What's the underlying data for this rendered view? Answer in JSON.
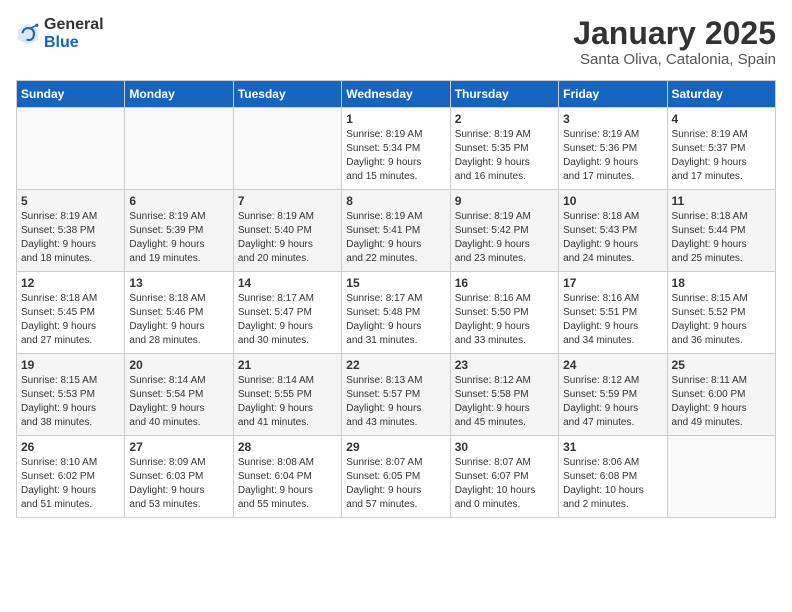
{
  "header": {
    "logo_general": "General",
    "logo_blue": "Blue",
    "month_year": "January 2025",
    "location": "Santa Oliva, Catalonia, Spain"
  },
  "weekdays": [
    "Sunday",
    "Monday",
    "Tuesday",
    "Wednesday",
    "Thursday",
    "Friday",
    "Saturday"
  ],
  "weeks": [
    [
      {
        "day": "",
        "text": ""
      },
      {
        "day": "",
        "text": ""
      },
      {
        "day": "",
        "text": ""
      },
      {
        "day": "1",
        "text": "Sunrise: 8:19 AM\nSunset: 5:34 PM\nDaylight: 9 hours\nand 15 minutes."
      },
      {
        "day": "2",
        "text": "Sunrise: 8:19 AM\nSunset: 5:35 PM\nDaylight: 9 hours\nand 16 minutes."
      },
      {
        "day": "3",
        "text": "Sunrise: 8:19 AM\nSunset: 5:36 PM\nDaylight: 9 hours\nand 17 minutes."
      },
      {
        "day": "4",
        "text": "Sunrise: 8:19 AM\nSunset: 5:37 PM\nDaylight: 9 hours\nand 17 minutes."
      }
    ],
    [
      {
        "day": "5",
        "text": "Sunrise: 8:19 AM\nSunset: 5:38 PM\nDaylight: 9 hours\nand 18 minutes."
      },
      {
        "day": "6",
        "text": "Sunrise: 8:19 AM\nSunset: 5:39 PM\nDaylight: 9 hours\nand 19 minutes."
      },
      {
        "day": "7",
        "text": "Sunrise: 8:19 AM\nSunset: 5:40 PM\nDaylight: 9 hours\nand 20 minutes."
      },
      {
        "day": "8",
        "text": "Sunrise: 8:19 AM\nSunset: 5:41 PM\nDaylight: 9 hours\nand 22 minutes."
      },
      {
        "day": "9",
        "text": "Sunrise: 8:19 AM\nSunset: 5:42 PM\nDaylight: 9 hours\nand 23 minutes."
      },
      {
        "day": "10",
        "text": "Sunrise: 8:18 AM\nSunset: 5:43 PM\nDaylight: 9 hours\nand 24 minutes."
      },
      {
        "day": "11",
        "text": "Sunrise: 8:18 AM\nSunset: 5:44 PM\nDaylight: 9 hours\nand 25 minutes."
      }
    ],
    [
      {
        "day": "12",
        "text": "Sunrise: 8:18 AM\nSunset: 5:45 PM\nDaylight: 9 hours\nand 27 minutes."
      },
      {
        "day": "13",
        "text": "Sunrise: 8:18 AM\nSunset: 5:46 PM\nDaylight: 9 hours\nand 28 minutes."
      },
      {
        "day": "14",
        "text": "Sunrise: 8:17 AM\nSunset: 5:47 PM\nDaylight: 9 hours\nand 30 minutes."
      },
      {
        "day": "15",
        "text": "Sunrise: 8:17 AM\nSunset: 5:48 PM\nDaylight: 9 hours\nand 31 minutes."
      },
      {
        "day": "16",
        "text": "Sunrise: 8:16 AM\nSunset: 5:50 PM\nDaylight: 9 hours\nand 33 minutes."
      },
      {
        "day": "17",
        "text": "Sunrise: 8:16 AM\nSunset: 5:51 PM\nDaylight: 9 hours\nand 34 minutes."
      },
      {
        "day": "18",
        "text": "Sunrise: 8:15 AM\nSunset: 5:52 PM\nDaylight: 9 hours\nand 36 minutes."
      }
    ],
    [
      {
        "day": "19",
        "text": "Sunrise: 8:15 AM\nSunset: 5:53 PM\nDaylight: 9 hours\nand 38 minutes."
      },
      {
        "day": "20",
        "text": "Sunrise: 8:14 AM\nSunset: 5:54 PM\nDaylight: 9 hours\nand 40 minutes."
      },
      {
        "day": "21",
        "text": "Sunrise: 8:14 AM\nSunset: 5:55 PM\nDaylight: 9 hours\nand 41 minutes."
      },
      {
        "day": "22",
        "text": "Sunrise: 8:13 AM\nSunset: 5:57 PM\nDaylight: 9 hours\nand 43 minutes."
      },
      {
        "day": "23",
        "text": "Sunrise: 8:12 AM\nSunset: 5:58 PM\nDaylight: 9 hours\nand 45 minutes."
      },
      {
        "day": "24",
        "text": "Sunrise: 8:12 AM\nSunset: 5:59 PM\nDaylight: 9 hours\nand 47 minutes."
      },
      {
        "day": "25",
        "text": "Sunrise: 8:11 AM\nSunset: 6:00 PM\nDaylight: 9 hours\nand 49 minutes."
      }
    ],
    [
      {
        "day": "26",
        "text": "Sunrise: 8:10 AM\nSunset: 6:02 PM\nDaylight: 9 hours\nand 51 minutes."
      },
      {
        "day": "27",
        "text": "Sunrise: 8:09 AM\nSunset: 6:03 PM\nDaylight: 9 hours\nand 53 minutes."
      },
      {
        "day": "28",
        "text": "Sunrise: 8:08 AM\nSunset: 6:04 PM\nDaylight: 9 hours\nand 55 minutes."
      },
      {
        "day": "29",
        "text": "Sunrise: 8:07 AM\nSunset: 6:05 PM\nDaylight: 9 hours\nand 57 minutes."
      },
      {
        "day": "30",
        "text": "Sunrise: 8:07 AM\nSunset: 6:07 PM\nDaylight: 10 hours\nand 0 minutes."
      },
      {
        "day": "31",
        "text": "Sunrise: 8:06 AM\nSunset: 6:08 PM\nDaylight: 10 hours\nand 2 minutes."
      },
      {
        "day": "",
        "text": ""
      }
    ]
  ]
}
